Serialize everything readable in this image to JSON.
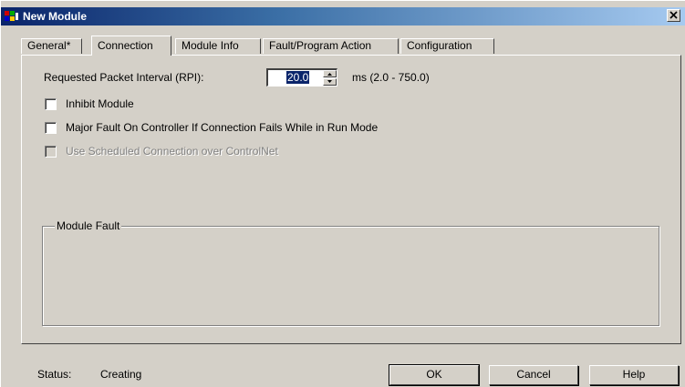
{
  "window": {
    "title": "New Module",
    "close_glyph": "×"
  },
  "tabs": [
    {
      "label": "General*"
    },
    {
      "label": "Connection",
      "active": true
    },
    {
      "label": "Module Info"
    },
    {
      "label": "Fault/Program Action"
    },
    {
      "label": "Configuration"
    }
  ],
  "connection": {
    "rpi_label": "Requested Packet Interval (RPI):",
    "rpi_value": "20.0",
    "rpi_units": "ms  (2.0 - 750.0)",
    "inhibit_label": "Inhibit Module",
    "inhibit_checked": false,
    "major_fault_label": "Major Fault On Controller If Connection Fails While in Run Mode",
    "major_fault_checked": false,
    "scheduled_label": "Use Scheduled Connection over ControlNet",
    "scheduled_enabled": false
  },
  "module_fault": {
    "label": "Module Fault",
    "text": ""
  },
  "status": {
    "label": "Status:",
    "value": "Creating"
  },
  "buttons": {
    "ok": "OK",
    "cancel": "Cancel",
    "help": "Help"
  },
  "colors": {
    "title_start": "#0a246a",
    "title_end": "#a6caf0",
    "dialog_bg": "#d4d0c8",
    "selection": "#0a246a"
  },
  "icons": {
    "app": "module-icon",
    "close": "close-icon",
    "spin_up": "arrow-up-icon",
    "spin_down": "arrow-down-icon"
  }
}
